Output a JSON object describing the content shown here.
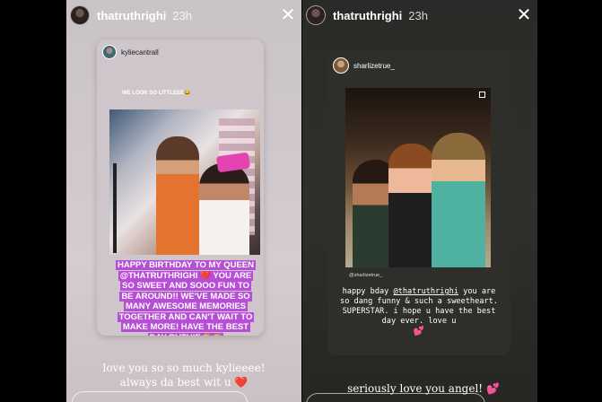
{
  "left_story": {
    "username": "thatruthrighi",
    "time": "23h",
    "close_icon": "close-icon",
    "card": {
      "username": "kyliecantrall",
      "small_caption": "WE LOOK SO LITTLEEE😂",
      "birthday_text": "HAPPY BIRTHDAY TO MY QUEEN @THATRUTHRIGHI ❤️ YOU ARE SO SWEET AND SOOO FUN TO BE AROUND!! WE'VE MADE SO MANY AWESOME MEMORIES TOGETHER AND CAN'T WAIT TO MAKE MORE! HAVE THE BEST DAY RUTHIE🥳🥳"
    },
    "caption_line1": "love you so so much kylieeee!",
    "caption_line2": "always da best wit u ❤️"
  },
  "right_story": {
    "username": "thatruthrighi",
    "time": "23h",
    "close_icon": "close-icon",
    "card": {
      "username": "sharlizetrue_",
      "photo_credit": "@sharlizetrue_",
      "text_before_mention": "happy bday ",
      "mention": "@thatruthrighi",
      "text_after_mention": " you are so dang funny & such a sweetheart. SUPERSTAR. i hope u have the best day ever. love u",
      "heart": "💕"
    },
    "caption": "seriously love you angel! ",
    "caption_heart": "💕"
  }
}
